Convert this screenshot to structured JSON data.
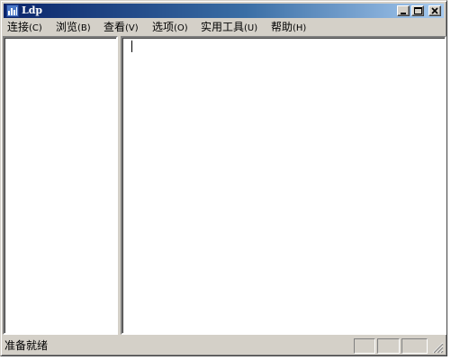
{
  "window": {
    "title": "Ldp",
    "icon": "ldp-app-icon"
  },
  "menubar": {
    "items": [
      {
        "label": "连接",
        "hotkey": "(C)"
      },
      {
        "label": "浏览",
        "hotkey": "(B)"
      },
      {
        "label": "查看",
        "hotkey": "(V)"
      },
      {
        "label": "选项",
        "hotkey": "(O)"
      },
      {
        "label": "实用工具",
        "hotkey": "(U)"
      },
      {
        "label": "帮助",
        "hotkey": "(H)"
      }
    ]
  },
  "statusbar": {
    "text": "准备就绪"
  },
  "colors": {
    "titlebar_start": "#0a246a",
    "titlebar_end": "#a6caf0",
    "face": "#d4d0c8"
  }
}
